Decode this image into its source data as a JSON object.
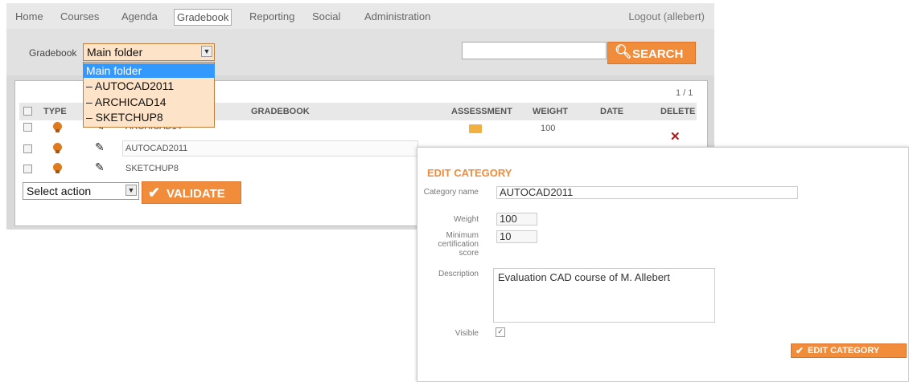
{
  "nav": {
    "items": [
      "Home",
      "Courses",
      "Agenda",
      "Gradebook",
      "Reporting",
      "Social",
      "Administration"
    ],
    "active": "Gradebook",
    "logout": "Logout (allebert)"
  },
  "filter": {
    "label": "Gradebook",
    "selected": "Main folder",
    "search_value": "",
    "search_button": "SEARCH"
  },
  "dropdown_options": [
    "Main folder",
    "– AUTOCAD2011",
    "– ARCHICAD14",
    "– SKETCHUP8"
  ],
  "table": {
    "pager": "1 / 1",
    "headers": {
      "type": "TYPE",
      "gradebook": "GRADEBOOK",
      "assessment": "ASSESSMENT",
      "weight": "WEIGHT",
      "date": "DATE",
      "delete": "DELETE"
    },
    "rows": [
      {
        "name": "ARCHICAD14",
        "weight": "100"
      },
      {
        "name": "AUTOCAD2011",
        "weight": ""
      },
      {
        "name": "SKETCHUP8",
        "weight": ""
      }
    ]
  },
  "actions": {
    "select_action": "Select action",
    "validate": "VALIDATE"
  },
  "edit_category": {
    "title": "EDIT CATEGORY",
    "labels": {
      "category_name": "Category name",
      "weight": "Weight",
      "min_score": "Minimum certification score",
      "description": "Description",
      "visible": "Visible"
    },
    "values": {
      "category_name": "AUTOCAD2011",
      "weight": "100",
      "min_score": "10",
      "description": "Evaluation CAD course of M. Allebert",
      "visible_check": "✓"
    },
    "submit": "EDIT CATEGORY"
  },
  "colors": {
    "accent": "#f08c3a",
    "selected": "#3399ff",
    "delete": "#b31414"
  }
}
